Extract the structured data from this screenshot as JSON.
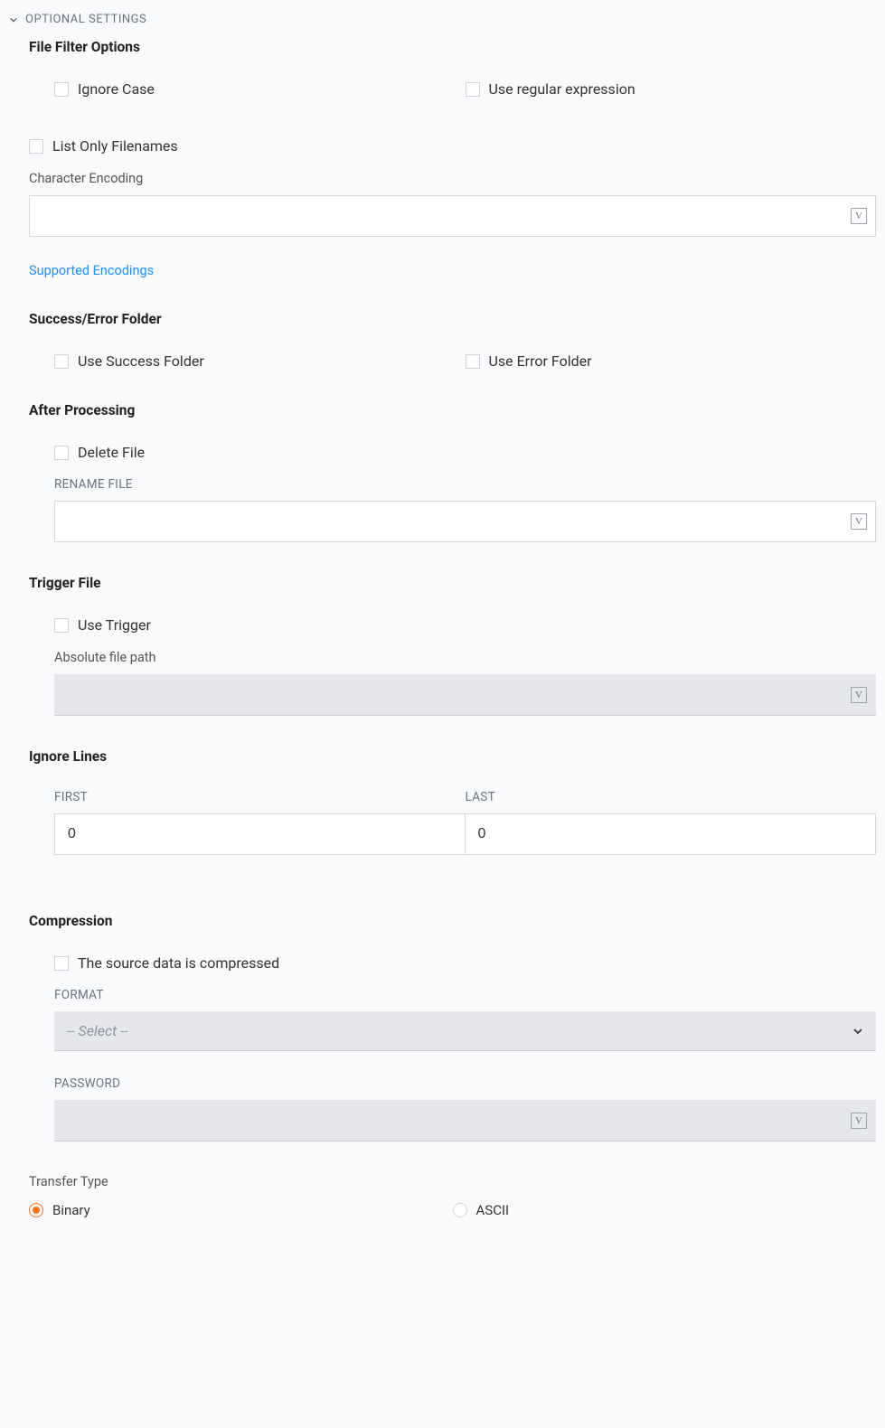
{
  "header": {
    "title": "OPTIONAL SETTINGS"
  },
  "sections": {
    "fileFilter": {
      "title": "File Filter Options",
      "ignoreCase": "Ignore Case",
      "useRegex": "Use regular expression",
      "listOnly": "List Only Filenames",
      "charEncodingLabel": "Character Encoding",
      "charEncodingValue": "",
      "supportedLink": "Supported Encodings"
    },
    "successError": {
      "title": "Success/Error Folder",
      "useSuccess": "Use Success Folder",
      "useError": "Use Error Folder"
    },
    "afterProcessing": {
      "title": "After Processing",
      "deleteFile": "Delete File",
      "renameLabel": "RENAME FILE",
      "renameValue": ""
    },
    "triggerFile": {
      "title": "Trigger File",
      "useTrigger": "Use Trigger",
      "pathLabel": "Absolute file path",
      "pathValue": ""
    },
    "ignoreLines": {
      "title": "Ignore Lines",
      "firstLabel": "FIRST",
      "firstValue": "0",
      "lastLabel": "LAST",
      "lastValue": "0"
    },
    "compression": {
      "title": "Compression",
      "sourceCompressed": "The source data is compressed",
      "formatLabel": "FORMAT",
      "formatPlaceholder": "-- Select --",
      "passwordLabel": "PASSWORD",
      "passwordValue": ""
    },
    "transferType": {
      "title": "Transfer Type",
      "binary": "Binary",
      "ascii": "ASCII"
    }
  }
}
